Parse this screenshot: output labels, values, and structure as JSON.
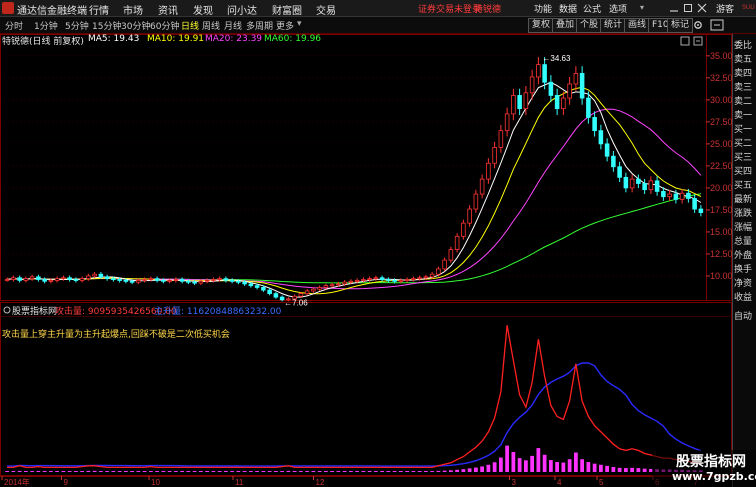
{
  "menubar": {
    "title": "通达信金融终端",
    "items": [
      "行情",
      "市场",
      "资讯",
      "发现",
      "问小达",
      "财富圈",
      "交易"
    ],
    "status_warning": "证券交易未登录",
    "status_stock": "特锐德",
    "right_items": [
      "功能",
      "数据",
      "公式",
      "选项"
    ],
    "guest": "游客"
  },
  "toolbar": {
    "periods": [
      "分时",
      "1分钟",
      "5分钟",
      "15分钟",
      "30分钟",
      "60分钟",
      "日线",
      "周线",
      "月线",
      "多周期",
      "更多"
    ],
    "active_period": "日线",
    "buttons": [
      "复权",
      "叠加",
      "个股",
      "统计",
      "画线",
      "F10",
      "标记"
    ]
  },
  "chart_header": {
    "stock": "特锐德(日线 前复权)",
    "ma5": "MA5: 19.43",
    "ma10": "MA10: 19.91",
    "ma20": "MA20: 23.39",
    "ma60": "MA60: 19.96"
  },
  "indicator_header": {
    "name": "股票指标网",
    "attack_label": "攻击量: 9095935426560.00",
    "main_label": "主升量: 11620848863232.00",
    "description": "攻击量上穿主升量为主升起爆点,回踩不破是二次低买机会"
  },
  "right_panel": {
    "items": [
      "委比",
      "卖五",
      "卖四",
      "卖三",
      "卖二",
      "卖一",
      "买一",
      "买二",
      "买三",
      "买四",
      "买五",
      "最新",
      "涨跌",
      "涨幅",
      "总量",
      "外盘",
      "换手",
      "净资",
      "收益"
    ],
    "bottom": "自动"
  },
  "watermark": {
    "line1": "股票指标网",
    "line2": "www.7gpzb.com"
  },
  "chart_data": {
    "type": "candlestick",
    "price_axis": {
      "ticks": [
        "35.00",
        "32.50",
        "30.00",
        "27.50",
        "25.00",
        "22.50",
        "20.00",
        "17.50",
        "15.00",
        "12.50",
        "10.00"
      ],
      "ylim": [
        7.5,
        36
      ]
    },
    "x_labels": [
      "2014年",
      "9",
      "10",
      "11",
      "12",
      "3",
      "4",
      "5",
      "6",
      "7"
    ],
    "annotations": {
      "high": "34.63",
      "low": "7.06"
    },
    "scale_top": "SUU",
    "colors": {
      "up": "#ff3333",
      "down": "#33ffff",
      "ma5": "#ffffff",
      "ma10": "#ffff00",
      "ma20": "#ff44ff",
      "ma60": "#33ff33",
      "attack": "#ff2020",
      "main": "#2a2aff",
      "volume": "#ff33ff"
    },
    "closes": [
      9.6,
      9.8,
      9.5,
      9.7,
      9.9,
      9.6,
      9.4,
      9.5,
      9.7,
      9.8,
      9.6,
      9.5,
      9.7,
      10.0,
      10.2,
      9.9,
      9.7,
      9.6,
      9.5,
      9.4,
      9.3,
      9.5,
      9.6,
      9.7,
      9.5,
      9.4,
      9.5,
      9.6,
      9.4,
      9.3,
      9.2,
      9.4,
      9.5,
      9.6,
      9.7,
      9.5,
      9.4,
      9.3,
      9.1,
      8.9,
      8.7,
      8.4,
      8.0,
      7.6,
      7.3,
      7.4,
      7.7,
      8.0,
      8.3,
      8.5,
      8.7,
      8.9,
      9.0,
      9.1,
      9.3,
      9.4,
      9.5,
      9.6,
      9.7,
      9.8,
      9.6,
      9.5,
      9.4,
      9.5,
      9.6,
      9.7,
      9.8,
      9.9,
      10.2,
      10.8,
      11.8,
      13.0,
      14.5,
      16.0,
      17.6,
      19.3,
      21.0,
      22.8,
      24.6,
      26.5,
      28.4,
      30.5,
      29.0,
      30.8,
      32.6,
      34.0,
      32.0,
      30.5,
      29.0,
      30.2,
      31.8,
      33.0,
      30.2,
      28.0,
      26.5,
      25.0,
      23.6,
      22.4,
      21.2,
      20.0,
      21.0,
      20.5,
      19.8,
      20.8,
      19.6,
      19.0,
      19.3,
      18.7,
      19.4,
      18.8,
      17.6,
      17.2
    ],
    "attack_volume": [
      0.3,
      0.3,
      0.4,
      0.3,
      0.3,
      0.35,
      0.3,
      0.3,
      0.3,
      0.3,
      0.3,
      0.3,
      0.35,
      0.4,
      0.4,
      0.35,
      0.3,
      0.3,
      0.3,
      0.3,
      0.3,
      0.3,
      0.3,
      0.35,
      0.3,
      0.3,
      0.3,
      0.3,
      0.3,
      0.3,
      0.3,
      0.3,
      0.3,
      0.3,
      0.3,
      0.3,
      0.3,
      0.3,
      0.3,
      0.3,
      0.3,
      0.3,
      0.3,
      0.3,
      0.35,
      0.4,
      0.3,
      0.3,
      0.3,
      0.3,
      0.3,
      0.3,
      0.3,
      0.3,
      0.3,
      0.3,
      0.3,
      0.3,
      0.3,
      0.3,
      0.3,
      0.3,
      0.3,
      0.3,
      0.3,
      0.3,
      0.3,
      0.3,
      0.3,
      0.4,
      0.5,
      0.6,
      0.8,
      1.0,
      1.3,
      1.6,
      2.0,
      2.6,
      3.5,
      5.2,
      9.5,
      7.2,
      5.0,
      4.2,
      5.8,
      8.6,
      6.2,
      4.3,
      3.6,
      3.4,
      4.6,
      7.0,
      4.6,
      3.6,
      3.0,
      2.6,
      2.2,
      1.8,
      1.5,
      1.4,
      1.5,
      1.4,
      1.2,
      1.1,
      1.0,
      0.9,
      0.9,
      0.8,
      0.8,
      0.7,
      0.6,
      0.6
    ],
    "main_volume_ratio": 1.28
  }
}
